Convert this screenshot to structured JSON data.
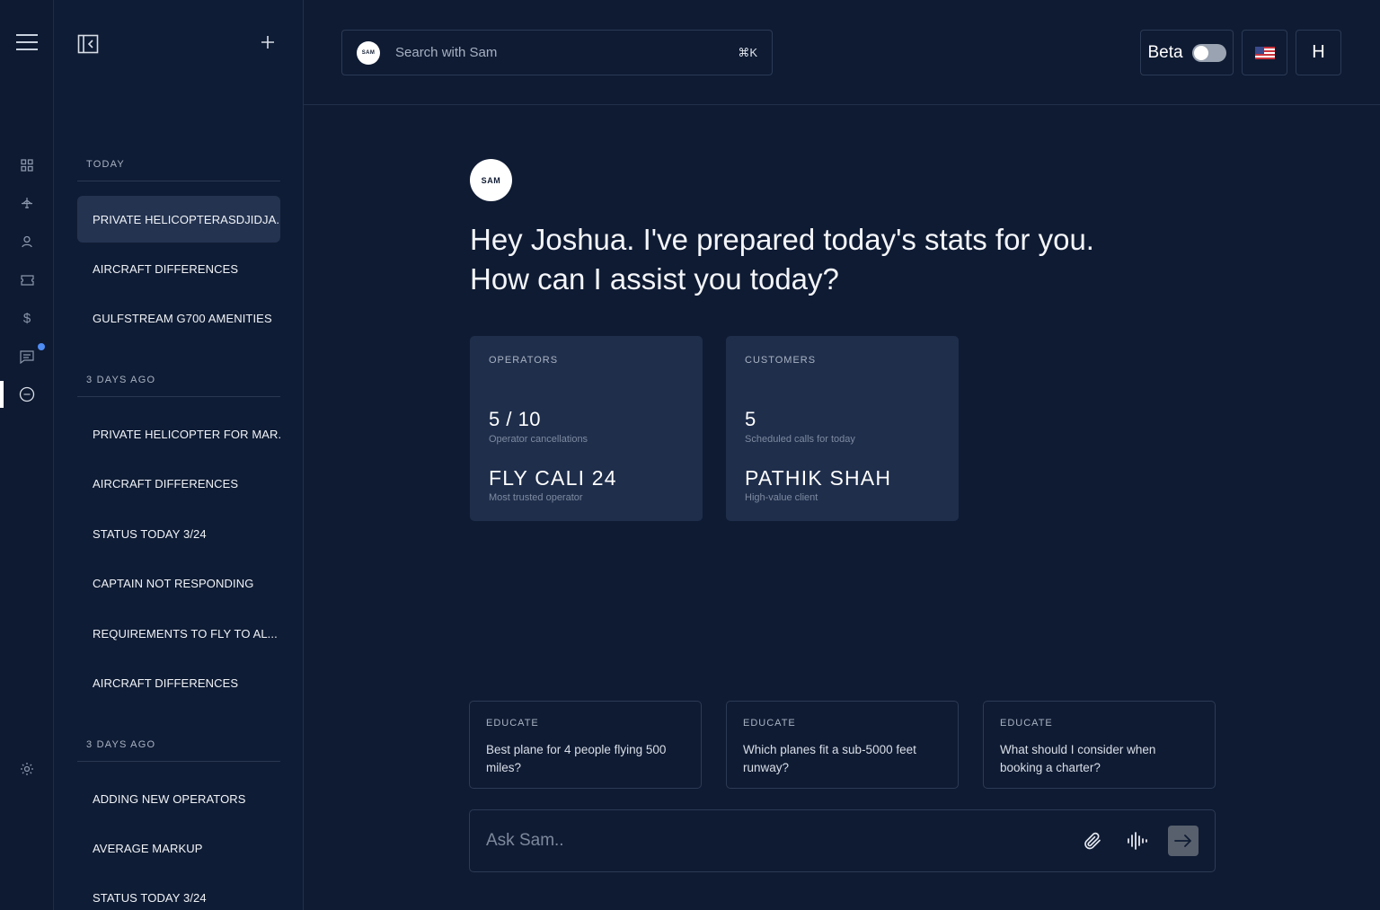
{
  "rail": {
    "icons": [
      "menu-icon",
      "grid-icon",
      "plane-icon",
      "user-icon",
      "ticket-icon",
      "dollar-icon",
      "chat-icon",
      "sam-icon",
      "gear-icon"
    ],
    "dollar_glyph": "$"
  },
  "sidebar": {
    "sections": [
      {
        "heading": "TODAY",
        "items": [
          "PRIVATE HELICOPTERASDJIDJA...",
          "AIRCRAFT DIFFERENCES",
          "GULFSTREAM G700 AMENITIES"
        ]
      },
      {
        "heading": "3 DAYS AGO",
        "items": [
          "PRIVATE HELICOPTER FOR MAR...",
          "AIRCRAFT DIFFERENCES",
          "STATUS TODAY 3/24",
          "CAPTAIN NOT RESPONDING",
          "REQUIREMENTS TO FLY TO AL...",
          "AIRCRAFT DIFFERENCES"
        ]
      },
      {
        "heading": "3 DAYS AGO",
        "items": [
          "ADDING NEW OPERATORS",
          "AVERAGE MARKUP",
          "STATUS TODAY 3/24"
        ]
      }
    ]
  },
  "topbar": {
    "sam_badge": "SAM",
    "search_placeholder": "Search with Sam",
    "shortcut": "⌘K",
    "beta_label": "Beta",
    "beta_enabled": false,
    "user_initial": "H"
  },
  "main": {
    "sam_badge": "SAM",
    "greeting_line1": "Hey  Joshua. I've prepared today's stats for you.",
    "greeting_line2": "How can I assist you today?",
    "stats": [
      {
        "label": "OPERATORS",
        "value": "5 / 10",
        "value_caption": "Operator cancellations",
        "highlight": "FLY CALI 24",
        "highlight_caption": "Most trusted operator"
      },
      {
        "label": "CUSTOMERS",
        "value": "5",
        "value_caption": "Scheduled calls for today",
        "highlight": "PATHIK SHAH",
        "highlight_caption": "High-value client"
      }
    ],
    "suggestions": [
      {
        "tag": "EDUCATE",
        "question": "Best plane for 4 people flying 500 miles?"
      },
      {
        "tag": "EDUCATE",
        "question": "Which planes fit a sub-5000 feet runway?"
      },
      {
        "tag": "EDUCATE",
        "question": "What should I consider when booking a charter?"
      }
    ],
    "ask_placeholder": "Ask Sam.."
  },
  "colors": {
    "background": "#0f1b33",
    "card": "#1f2e4b",
    "selected_item": "#243350",
    "notification_dot": "#4f8df5"
  }
}
